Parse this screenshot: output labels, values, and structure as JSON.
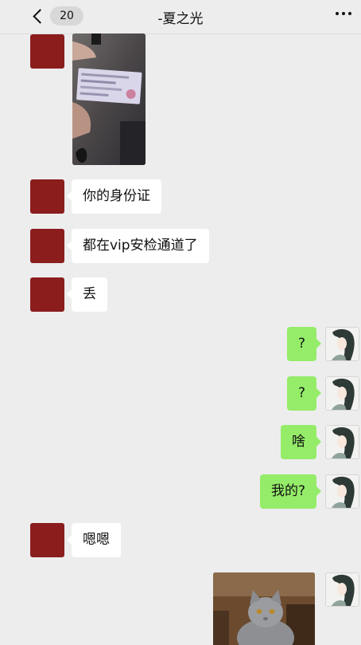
{
  "header": {
    "back_count": "20",
    "title": "-夏之光"
  },
  "messages": [
    {
      "side": "in",
      "type": "image",
      "image": "id-card-photo"
    },
    {
      "side": "in",
      "type": "text",
      "text": "你的身份证"
    },
    {
      "side": "in",
      "type": "text",
      "text": "都在vip安检通道了"
    },
    {
      "side": "in",
      "type": "text",
      "text": "丢"
    },
    {
      "side": "out",
      "type": "text",
      "text": "?"
    },
    {
      "side": "out",
      "type": "text",
      "text": "?"
    },
    {
      "side": "out",
      "type": "text",
      "text": "啥"
    },
    {
      "side": "out",
      "type": "text",
      "text": "我的?"
    },
    {
      "side": "in",
      "type": "text",
      "text": "嗯嗯"
    },
    {
      "side": "out",
      "type": "image",
      "image": "gray-cat-photo"
    }
  ],
  "colors": {
    "background": "#ededed",
    "incoming_bubble": "#ffffff",
    "outgoing_bubble": "#95ec69",
    "contact_avatar": "#8b1d1d"
  }
}
